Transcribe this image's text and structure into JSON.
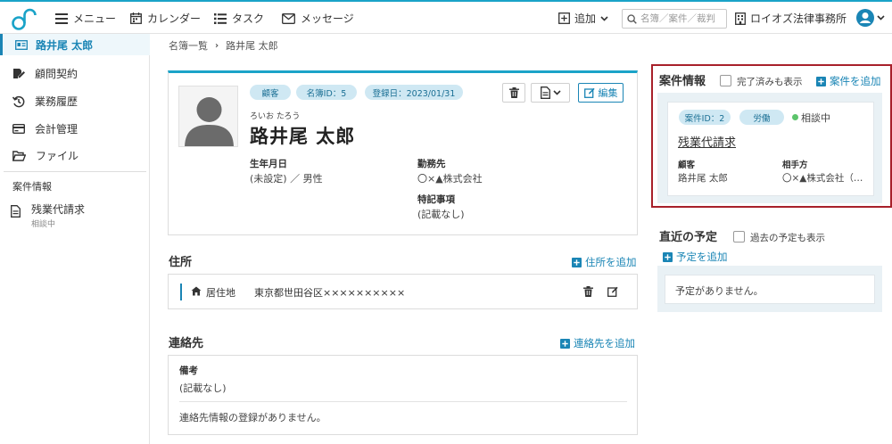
{
  "nav": {
    "menu": "メニュー",
    "calendar": "カレンダー",
    "task": "タスク",
    "message": "メッセージ",
    "add": "追加",
    "search_placeholder": "名簿／案件／裁判",
    "office": "ロイオズ法律事務所"
  },
  "sidebar": {
    "active": "路井尾 太郎",
    "items": [
      "顧問契約",
      "業務履歴",
      "会計管理",
      "ファイル"
    ],
    "section": "案件情報",
    "case_title": "残業代請求",
    "case_status": "相談中"
  },
  "breadcrumb": {
    "root": "名簿一覧",
    "current": "路井尾 太郎"
  },
  "profile": {
    "tags": [
      "顧客",
      "名簿ID：5",
      "登録日：2023/01/31"
    ],
    "edit": "編集",
    "kana": "ろいお たろう",
    "name": "路井尾 太郎",
    "birth_label": "生年月日",
    "birth_value": "(未設定) ／ 男性",
    "work_label": "勤務先",
    "work_value": "〇×▲株式会社",
    "notes_label": "特記事項",
    "notes_value": "(記載なし)"
  },
  "address": {
    "title": "住所",
    "add": "住所を追加",
    "type": "居住地",
    "value": "東京都世田谷区××××××××××"
  },
  "contact": {
    "title": "連絡先",
    "add": "連絡先を追加",
    "remark_label": "備考",
    "remark_value": "(記載なし)",
    "empty": "連絡先情報の登録がありません。"
  },
  "case_panel": {
    "title": "案件情報",
    "show_done": "完了済みも表示",
    "add": "案件を追加",
    "case_id": "案件ID：2",
    "category": "労働",
    "status": "相談中",
    "case_name": "残業代請求",
    "client_label": "顧客",
    "client_value": "路井尾 太郎",
    "opponent_label": "相手方",
    "opponent_value": "〇×▲株式会社（…"
  },
  "schedule": {
    "title": "直近の予定",
    "show_past": "過去の予定も表示",
    "add": "予定を追加",
    "empty": "予定がありません。"
  },
  "colors": {
    "accent": "#1a85b5",
    "topline": "#1aa3c8",
    "highlight": "#a8202a",
    "tag_bg": "#cfe8f3",
    "status_green": "#5cc46b"
  }
}
